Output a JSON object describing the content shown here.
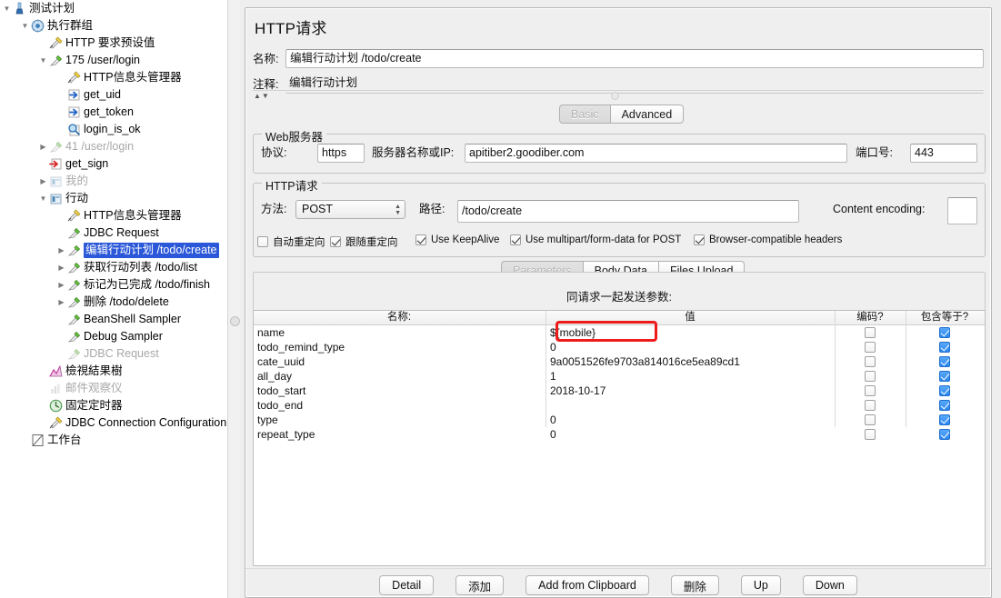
{
  "tree": {
    "items": [
      {
        "label": "测试计划",
        "indent": 0,
        "toggle": "open",
        "icon": "test-plan-icon",
        "dim": false,
        "selected": false
      },
      {
        "label": "执行群组",
        "indent": 1,
        "toggle": "open",
        "icon": "thread-group-icon",
        "dim": false,
        "selected": false
      },
      {
        "label": "HTTP 要求预设值",
        "indent": 2,
        "toggle": "none",
        "icon": "config-element-icon",
        "dim": false,
        "selected": false
      },
      {
        "label": "175 /user/login",
        "indent": 2,
        "toggle": "open",
        "icon": "sampler-icon",
        "dim": false,
        "selected": false
      },
      {
        "label": "HTTP信息头管理器",
        "indent": 3,
        "toggle": "none",
        "icon": "config-element-icon",
        "dim": false,
        "selected": false
      },
      {
        "label": "get_uid",
        "indent": 3,
        "toggle": "none",
        "icon": "post-processor-icon",
        "dim": false,
        "selected": false
      },
      {
        "label": "get_token",
        "indent": 3,
        "toggle": "none",
        "icon": "post-processor-icon",
        "dim": false,
        "selected": false
      },
      {
        "label": "login_is_ok",
        "indent": 3,
        "toggle": "none",
        "icon": "assertion-icon",
        "dim": false,
        "selected": false
      },
      {
        "label": "41 /user/login",
        "indent": 2,
        "toggle": "closed",
        "icon": "sampler-icon",
        "dim": true,
        "selected": false
      },
      {
        "label": "get_sign",
        "indent": 2,
        "toggle": "none",
        "icon": "pre-processor-icon",
        "dim": false,
        "selected": false
      },
      {
        "label": "我的",
        "indent": 2,
        "toggle": "closed",
        "icon": "controller-icon",
        "dim": true,
        "selected": false
      },
      {
        "label": "行动",
        "indent": 2,
        "toggle": "open",
        "icon": "controller-icon",
        "dim": false,
        "selected": false
      },
      {
        "label": "HTTP信息头管理器",
        "indent": 3,
        "toggle": "none",
        "icon": "config-element-icon",
        "dim": false,
        "selected": false
      },
      {
        "label": "JDBC Request",
        "indent": 3,
        "toggle": "none",
        "icon": "sampler-icon",
        "dim": false,
        "selected": false
      },
      {
        "label": "编辑行动计划  /todo/create",
        "indent": 3,
        "toggle": "closed",
        "icon": "sampler-icon",
        "dim": false,
        "selected": true
      },
      {
        "label": "获取行动列表  /todo/list",
        "indent": 3,
        "toggle": "closed",
        "icon": "sampler-icon",
        "dim": false,
        "selected": false
      },
      {
        "label": "标记为已完成  /todo/finish",
        "indent": 3,
        "toggle": "closed",
        "icon": "sampler-icon",
        "dim": false,
        "selected": false
      },
      {
        "label": "删除  /todo/delete",
        "indent": 3,
        "toggle": "closed",
        "icon": "sampler-icon",
        "dim": false,
        "selected": false
      },
      {
        "label": "BeanShell Sampler",
        "indent": 3,
        "toggle": "none",
        "icon": "sampler-icon",
        "dim": false,
        "selected": false
      },
      {
        "label": "Debug Sampler",
        "indent": 3,
        "toggle": "none",
        "icon": "sampler-icon",
        "dim": false,
        "selected": false
      },
      {
        "label": "JDBC Request",
        "indent": 3,
        "toggle": "none",
        "icon": "sampler-icon",
        "dim": true,
        "selected": false
      },
      {
        "label": "檢視結果樹",
        "indent": 2,
        "toggle": "none",
        "icon": "listener-icon",
        "dim": false,
        "selected": false
      },
      {
        "label": "邮件观察仪",
        "indent": 2,
        "toggle": "none",
        "icon": "listener-gray-icon",
        "dim": true,
        "selected": false
      },
      {
        "label": "固定定时器",
        "indent": 2,
        "toggle": "none",
        "icon": "timer-icon",
        "dim": false,
        "selected": false
      },
      {
        "label": "JDBC Connection Configuration",
        "indent": 2,
        "toggle": "none",
        "icon": "config-element-icon",
        "dim": false,
        "selected": false
      },
      {
        "label": "工作台",
        "indent": 1,
        "toggle": "none",
        "icon": "workbench-icon",
        "dim": false,
        "selected": false
      }
    ]
  },
  "panel": {
    "title": "HTTP请求",
    "name_label": "名称:",
    "name_value": "编辑行动计划  /todo/create",
    "comment_label": "注释:",
    "comment_value": "编辑行动计划",
    "mode_tabs": [
      {
        "label": "Basic",
        "active": true
      },
      {
        "label": "Advanced",
        "active": false
      }
    ]
  },
  "web_server": {
    "group_title": "Web服务器",
    "protocol_label": "协议:",
    "protocol_value": "https",
    "server_label": "服务器名称或IP:",
    "server_value": "apitiber2.goodiber.com",
    "port_label": "端口号:",
    "port_value": "443"
  },
  "http_request": {
    "group_title": "HTTP请求",
    "method_label": "方法:",
    "method_value": "POST",
    "path_label": "路径:",
    "path_value": "/todo/create",
    "encoding_label": "Content encoding:",
    "encoding_value": "",
    "options": [
      {
        "label": "自动重定向",
        "checked": false
      },
      {
        "label": "跟随重定向",
        "checked": true
      },
      {
        "label": "Use KeepAlive",
        "checked": true
      },
      {
        "label": "Use multipart/form-data for POST",
        "checked": true
      },
      {
        "label": "Browser-compatible headers",
        "checked": true
      }
    ]
  },
  "data_tabs": [
    {
      "label": "Parameters",
      "active": true
    },
    {
      "label": "Body Data",
      "active": false
    },
    {
      "label": "Files Upload",
      "active": false
    }
  ],
  "params": {
    "caption": "同请求一起发送参数:",
    "columns": [
      "名称:",
      "值",
      "编码?",
      "包含等于?"
    ],
    "rows": [
      {
        "name": "name",
        "value": "${mobile}",
        "encode": false,
        "include_equals": true,
        "highlighted": true
      },
      {
        "name": "todo_remind_type",
        "value": "0",
        "encode": false,
        "include_equals": true,
        "highlighted": false
      },
      {
        "name": "cate_uuid",
        "value": "9a0051526fe9703a814016ce5ea89cd1",
        "encode": false,
        "include_equals": true,
        "highlighted": false
      },
      {
        "name": "all_day",
        "value": "1",
        "encode": false,
        "include_equals": true,
        "highlighted": false
      },
      {
        "name": "todo_start",
        "value": "2018-10-17",
        "encode": false,
        "include_equals": true,
        "highlighted": false
      },
      {
        "name": "todo_end",
        "value": "",
        "encode": false,
        "include_equals": true,
        "highlighted": false
      },
      {
        "name": "type",
        "value": "0",
        "encode": false,
        "include_equals": true,
        "highlighted": false
      },
      {
        "name": "repeat_type",
        "value": "0",
        "encode": false,
        "include_equals": true,
        "highlighted": false
      }
    ]
  },
  "buttons": [
    {
      "label": "Detail"
    },
    {
      "label": "添加"
    },
    {
      "label": "Add from Clipboard"
    },
    {
      "label": "删除"
    },
    {
      "label": "Up"
    },
    {
      "label": "Down"
    }
  ],
  "colors": {
    "selection": "#2b58d8",
    "highlight_box": "#ee1b1b",
    "checkbox_on": "#2a86ef",
    "panel_bg": "#efefef"
  }
}
